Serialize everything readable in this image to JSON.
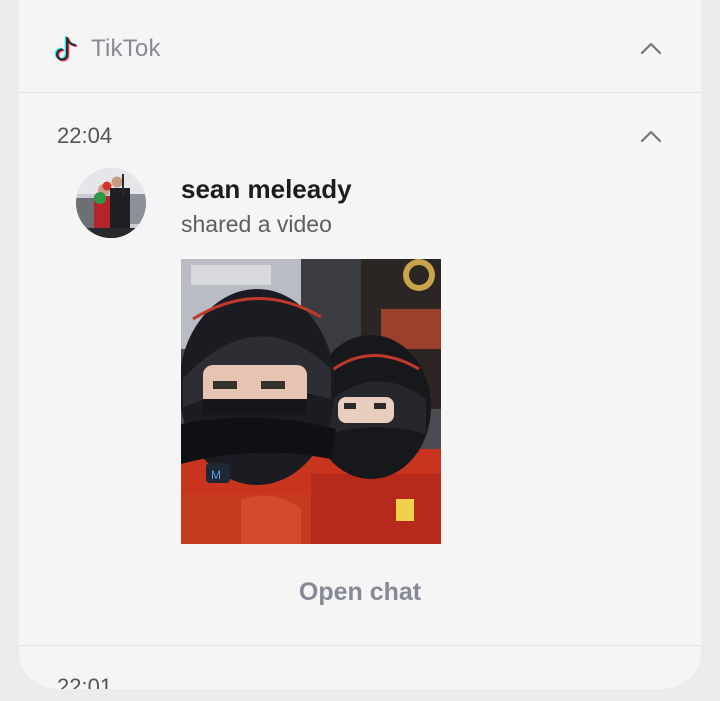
{
  "app": {
    "name": "TikTok",
    "icon": "tiktok-logo-icon"
  },
  "notification": {
    "time": "22:04",
    "sender": "sean meleady",
    "message": "shared a video",
    "action_label": "Open chat"
  },
  "next_notification": {
    "time": "22:01"
  },
  "colors": {
    "background": "#ececec",
    "card": "#f5f5f5",
    "muted_text": "#888b93",
    "action_text": "#868a97"
  }
}
